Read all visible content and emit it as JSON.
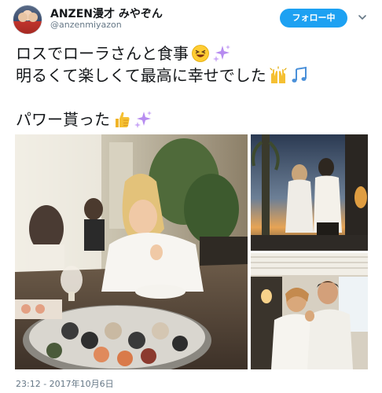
{
  "user": {
    "display_name": "ANZEN漫才 みやぞん",
    "screen_name": "@anzenmiyazon",
    "avatar_icon": "avatar-photo"
  },
  "follow_button": {
    "label": "フォロー中"
  },
  "more_menu": {
    "icon": "chevron-down-icon"
  },
  "tweet": {
    "lines": [
      {
        "text": "ロスでローラさんと食事",
        "emojis": [
          "grinning-squinting-face-emoji",
          "sparkles-emoji"
        ]
      },
      {
        "text": "明るくて楽しくて最高に幸せでした",
        "emojis": [
          "raising-hands-emoji",
          "musical-notes-emoji"
        ]
      },
      {
        "text": "パワー貰った",
        "emojis": [
          "thumbs-up-emoji",
          "sparkles-emoji"
        ]
      }
    ]
  },
  "media": {
    "photos": [
      {
        "name": "photo-dinner-table"
      },
      {
        "name": "photo-sunset-balcony"
      },
      {
        "name": "photo-restaurant-selfie"
      }
    ]
  },
  "timestamp": "23:12 - 2017年10月6日",
  "colors": {
    "accent": "#1da1f2",
    "text": "#14171a",
    "secondary_text": "#657786"
  }
}
